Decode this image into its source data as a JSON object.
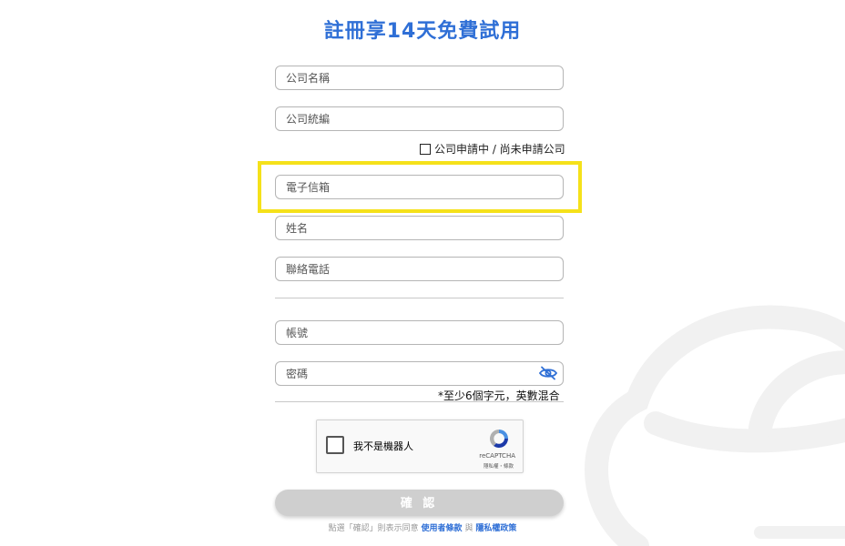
{
  "title": "註冊享14天免費試用",
  "fields": {
    "company_name": {
      "placeholder": "公司名稱"
    },
    "company_tax_id": {
      "placeholder": "公司統編"
    },
    "email": {
      "placeholder": "電子信箱"
    },
    "name": {
      "placeholder": "姓名"
    },
    "phone": {
      "placeholder": "聯絡電話"
    },
    "account": {
      "placeholder": "帳號"
    },
    "password": {
      "placeholder": "密碼"
    }
  },
  "company_pending_label": "公司申請中 / 尚未申請公司",
  "password_hint": "*至少6個字元，英數混合",
  "captcha": {
    "label": "我不是機器人",
    "brand": "reCAPTCHA",
    "privacy": "隱私權",
    "separator": "・",
    "terms": "條款"
  },
  "confirm_label": "確 認",
  "terms_line": {
    "prefix": "點選「確認」則表示同意",
    "terms_link": "使用者條款",
    "and": "與",
    "privacy_link": "隱私權政策"
  },
  "colors": {
    "accent": "#2f6fd6",
    "highlight": "#f5e11a",
    "button_disabled": "#cfcfcf"
  },
  "icons": {
    "password_toggle": "eye-slash-icon",
    "captcha_logo": "recaptcha-icon",
    "background": "cloud-icon"
  }
}
